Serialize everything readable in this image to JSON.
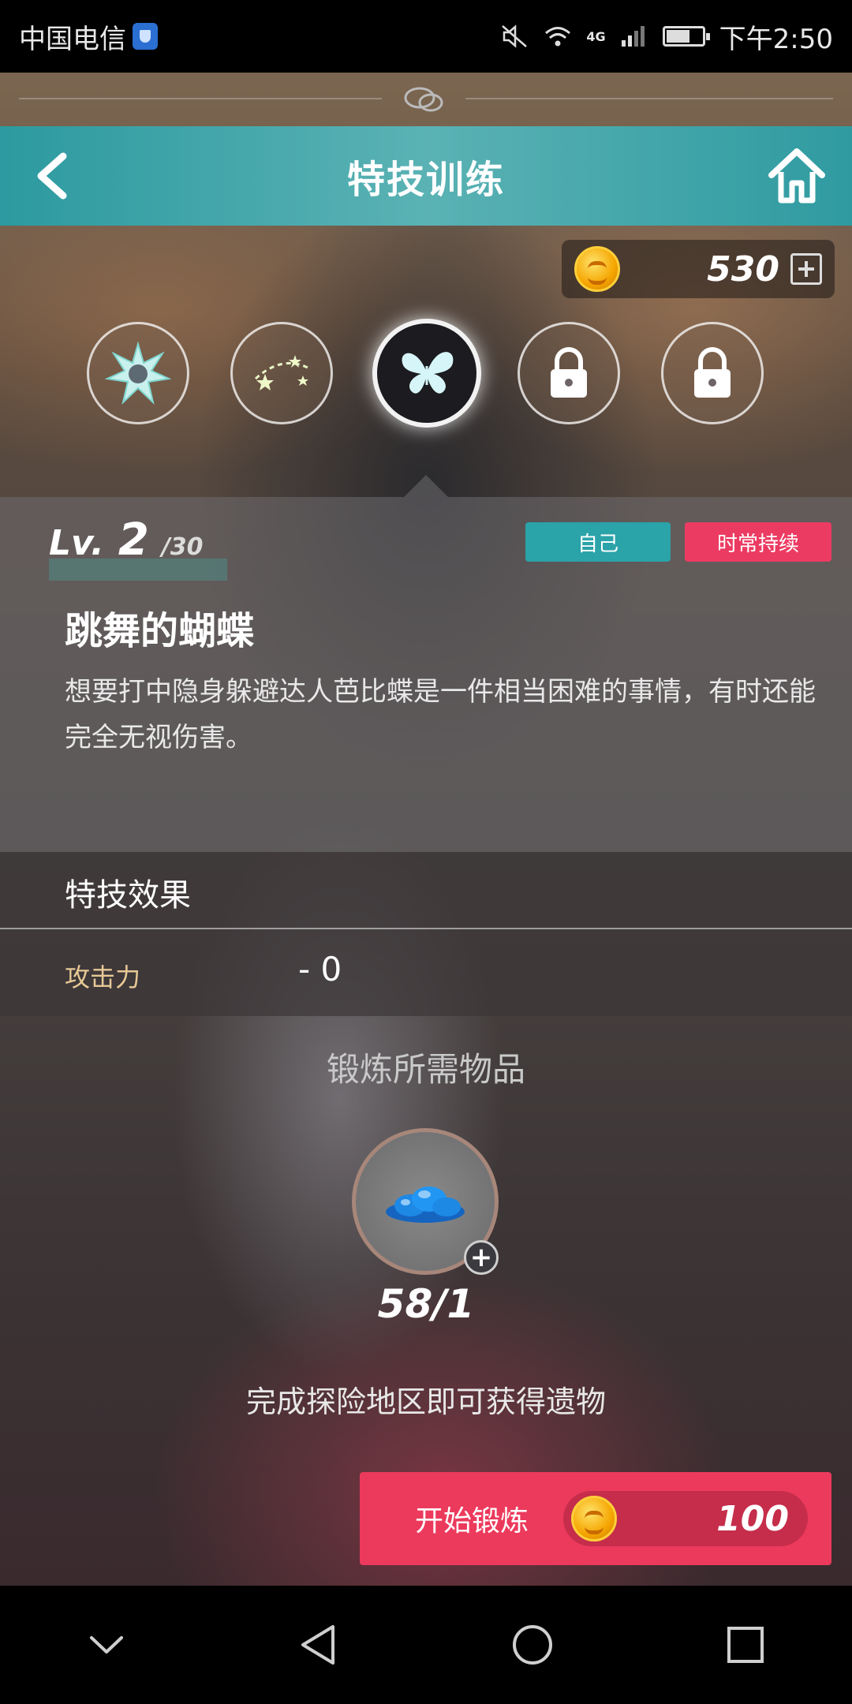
{
  "status_bar": {
    "carrier": "中国电信",
    "network": "4G",
    "time": "下午2:50"
  },
  "header": {
    "title": "特技训练"
  },
  "currency": {
    "amount": "530"
  },
  "skills": [
    {
      "icon": "flower-burst-icon",
      "state": "available"
    },
    {
      "icon": "stars-orbit-icon",
      "state": "available"
    },
    {
      "icon": "butterfly-icon",
      "state": "selected"
    },
    {
      "icon": "lock-icon",
      "state": "locked"
    },
    {
      "icon": "lock-icon",
      "state": "locked"
    }
  ],
  "skill_info": {
    "level_prefix": "Lv.",
    "level": "2",
    "level_max": "/30",
    "tag_target": "自己",
    "tag_duration": "时常持续",
    "name": "跳舞的蝴蝶",
    "description": "想要打中隐身躲避达人芭比蝶是一件相当困难的事情，有时还能完全无视伤害。"
  },
  "effect": {
    "title": "特技效果",
    "stat_label": "攻击力",
    "stat_value": "- 0"
  },
  "requirements": {
    "title": "锻炼所需物品",
    "item_icon": "blue-crystal-icon",
    "count": "58/1",
    "hint": "完成探险地区即可获得遗物"
  },
  "action": {
    "label": "开始锻炼",
    "cost": "100"
  },
  "colors": {
    "header_teal": "#2c9aa0",
    "tag_self": "#2aa3a9",
    "tag_continuous": "#ec3b62",
    "start_button": "#ec3a5c",
    "effect_label": "#e7c995"
  }
}
